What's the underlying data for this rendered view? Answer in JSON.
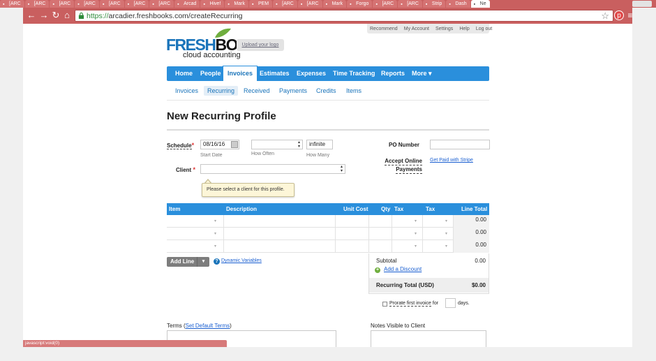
{
  "browser": {
    "tabs": [
      {
        "label": "[ARC"
      },
      {
        "label": "[ARC"
      },
      {
        "label": "[ARC"
      },
      {
        "label": "[ARC"
      },
      {
        "label": "[ARC"
      },
      {
        "label": "[ARC"
      },
      {
        "label": "[ARC"
      },
      {
        "label": "Arcad"
      },
      {
        "label": "Hive!"
      },
      {
        "label": "Mark"
      },
      {
        "label": "PEM"
      },
      {
        "label": "[ARC"
      },
      {
        "label": "[ARC"
      },
      {
        "label": "Mark"
      },
      {
        "label": "Forgo"
      },
      {
        "label": "[ARC"
      },
      {
        "label": "[ARC"
      },
      {
        "label": "Strip"
      },
      {
        "label": "Dash"
      },
      {
        "label": "Ne"
      }
    ],
    "url_scheme": "https://",
    "url_rest": "arcadier.freshbooks.com/createRecurring",
    "status_text": "javascript:void(0)",
    "accent": "#c95f5f"
  },
  "toplinks": [
    "Recommend",
    "My Account",
    "Settings",
    "Help",
    "Log out"
  ],
  "logo": {
    "fresh": "FRESH",
    "books": "BOOKS",
    "tagline": "cloud accounting",
    "upload": "Upload your logo"
  },
  "mainnav": [
    {
      "label": "Home"
    },
    {
      "label": "People"
    },
    {
      "label": "Invoices"
    },
    {
      "label": "Estimates"
    },
    {
      "label": "Expenses"
    },
    {
      "label": "Time Tracking"
    },
    {
      "label": "Reports"
    },
    {
      "label": "More ▾"
    }
  ],
  "subnav": [
    {
      "label": "Invoices"
    },
    {
      "label": "Recurring"
    },
    {
      "label": "Received"
    },
    {
      "label": "Payments"
    },
    {
      "label": "Credits"
    },
    {
      "label": "Items"
    }
  ],
  "title": "New Recurring Profile",
  "form": {
    "schedule_label": "Schedule",
    "start_date": "08/16/16",
    "start_date_hint": "Start Date",
    "how_often_hint": "How Often",
    "how_many_value": "infinite",
    "how_many_hint": "How Many",
    "client_label": "Client",
    "client_tooltip": "Please select a client for this profile.",
    "po_label": "PO Number",
    "accept_online_line1": "Accept Online",
    "accept_online_line2": "Payments",
    "stripe_link": "Get Paid with Stripe"
  },
  "table": {
    "headers": {
      "item": "Item",
      "description": "Description",
      "unit_cost": "Unit Cost",
      "qty": "Qty",
      "tax1": "Tax",
      "tax2": "Tax",
      "line_total": "Line Total"
    },
    "rows": [
      {
        "total": "0.00"
      },
      {
        "total": "0.00"
      },
      {
        "total": "0.00"
      }
    ]
  },
  "actions": {
    "add_line": "Add Line",
    "dynamic_variables": "Dynamic Variables"
  },
  "totals": {
    "subtotal_label": "Subtotal",
    "subtotal_value": "0.00",
    "add_discount": "Add a Discount",
    "recurring_total_label": "Recurring Total (USD)",
    "recurring_total_value": "$0.00"
  },
  "prorate": {
    "before": "Prorate first invoice",
    "for": "for",
    "days": "days."
  },
  "terms": {
    "label": "Terms (",
    "link": "Set Default Terms",
    "close": ")"
  },
  "notes_label": "Notes Visible to Client"
}
